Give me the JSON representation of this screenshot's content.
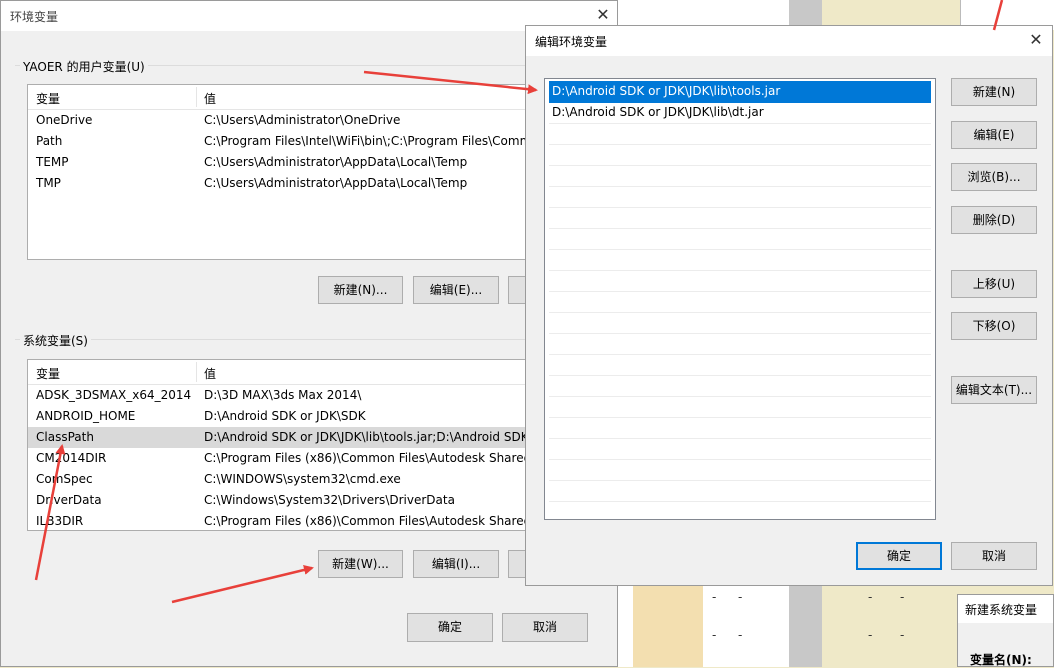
{
  "env_window": {
    "title": "环境变量",
    "user_group_label": "YAOER 的用户变量(U)",
    "user_columns": [
      "变量",
      "值"
    ],
    "user_vars": [
      {
        "name": "OneDrive",
        "value": "C:\\Users\\Administrator\\OneDrive"
      },
      {
        "name": "Path",
        "value": "C:\\Program Files\\Intel\\WiFi\\bin\\;C:\\Program Files\\Comm"
      },
      {
        "name": "TEMP",
        "value": "C:\\Users\\Administrator\\AppData\\Local\\Temp"
      },
      {
        "name": "TMP",
        "value": "C:\\Users\\Administrator\\AppData\\Local\\Temp"
      }
    ],
    "user_buttons": {
      "new": "新建(N)...",
      "edit": "编辑(E)..."
    },
    "system_group_label": "系统变量(S)",
    "system_columns": [
      "变量",
      "值"
    ],
    "system_vars": [
      {
        "name": "ADSK_3DSMAX_x64_2014",
        "value": "D:\\3D MAX\\3ds Max 2014\\"
      },
      {
        "name": "ANDROID_HOME",
        "value": "D:\\Android SDK or JDK\\SDK"
      },
      {
        "name": "ClassPath",
        "value": "D:\\Android SDK or JDK\\JDK\\lib\\tools.jar;D:\\Android SDK"
      },
      {
        "name": "CM2014DIR",
        "value": "C:\\Program Files (x86)\\Common Files\\Autodesk Shared\\"
      },
      {
        "name": "ComSpec",
        "value": "C:\\WINDOWS\\system32\\cmd.exe"
      },
      {
        "name": "DriverData",
        "value": "C:\\Windows\\System32\\Drivers\\DriverData"
      },
      {
        "name": "ILB3DIR",
        "value": "C:\\Program Files (x86)\\Common Files\\Autodesk Shared\\"
      }
    ],
    "system_buttons": {
      "new": "新建(W)...",
      "edit": "编辑(I)..."
    },
    "ok": "确定",
    "cancel": "取消"
  },
  "edit_window": {
    "title": "编辑环境变量",
    "entries": [
      "D:\\Android SDK or JDK\\JDK\\lib\\tools.jar",
      "D:\\Android SDK or JDK\\JDK\\lib\\dt.jar"
    ],
    "buttons": {
      "new": "新建(N)",
      "edit": "编辑(E)",
      "browse": "浏览(B)...",
      "delete": "删除(D)",
      "move_up": "上移(U)",
      "move_down": "下移(O)",
      "edit_text": "编辑文本(T)..."
    },
    "ok": "确定",
    "cancel": "取消"
  },
  "new_sys_window": {
    "title": "新建系统变量",
    "var_name_label": "变量名(N):"
  },
  "colors": {
    "selection": "#0078d7",
    "arrow": "#e8403a"
  }
}
